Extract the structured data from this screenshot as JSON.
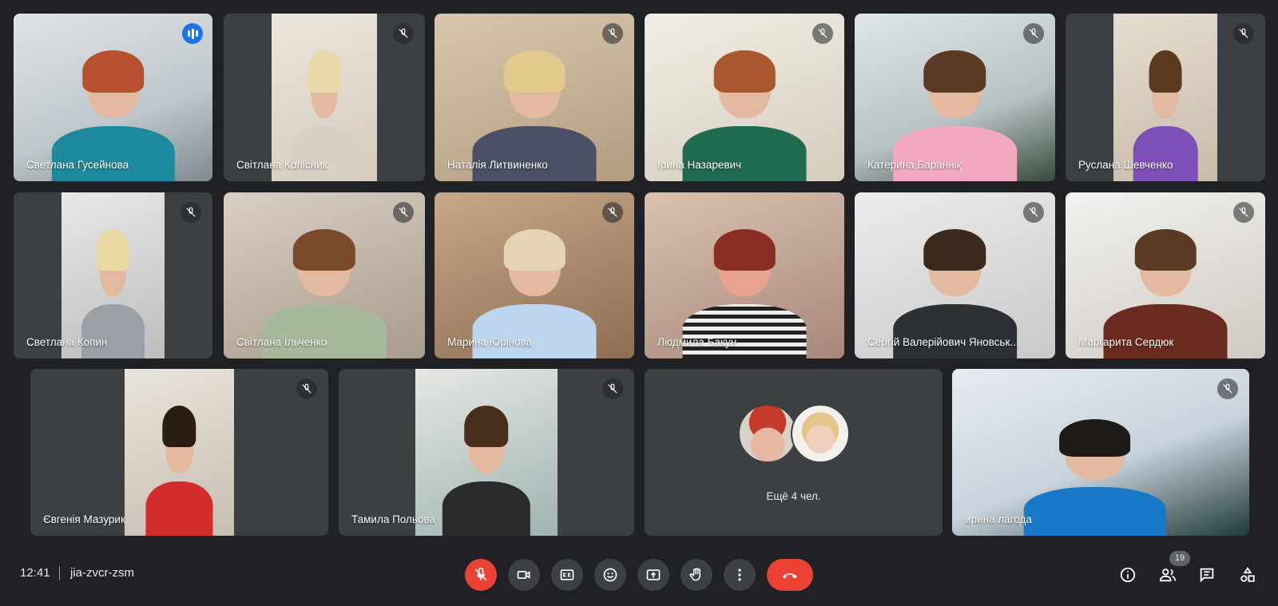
{
  "participants": [
    {
      "name": "Светлана Гусейнова",
      "speaking": true
    },
    {
      "name": "Світлана Колісник"
    },
    {
      "name": "Наталія Литвиненко"
    },
    {
      "name": "Ірина Назаревич"
    },
    {
      "name": "Катерина Баранніқ"
    },
    {
      "name": "Руслана Шевченко"
    },
    {
      "name": "Светлана Копин"
    },
    {
      "name": "Світлана Ільченко"
    },
    {
      "name": "Марина Юрінова"
    },
    {
      "name": "Людмила Бакун"
    },
    {
      "name": "Сергій Валерійович Яновськ..."
    },
    {
      "name": "Маргарита Сердюк"
    },
    {
      "name": "Євгенія Мазурик"
    },
    {
      "name": "Тамила Польова"
    },
    {
      "name": "ирина лагода"
    }
  ],
  "more_tile": {
    "label": "Ещё 4 чел."
  },
  "meeting": {
    "time": "12:41",
    "code": "jia-zvcr-zsm"
  },
  "people_count": "19",
  "colors": {
    "background": "#202124",
    "tile": "#3c4043",
    "accent": "#8ab4f8",
    "danger": "#ea4335",
    "speaking": "#1a73e8"
  },
  "controls": [
    "microphone-off-icon",
    "camera-icon",
    "captions-icon",
    "emoji-icon",
    "present-icon",
    "raise-hand-icon",
    "more-options-icon",
    "leave-call-icon"
  ],
  "right_controls": [
    "info-icon",
    "people-icon",
    "chat-icon",
    "activities-icon"
  ]
}
